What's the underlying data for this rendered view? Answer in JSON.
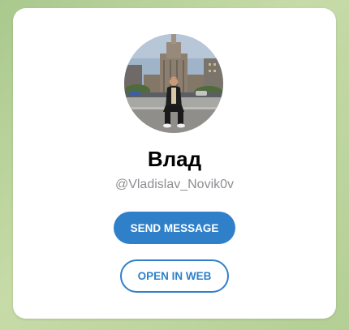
{
  "profile": {
    "display_name": "Влад",
    "username": "@Vladislav_Novik0v"
  },
  "actions": {
    "send_message_label": "SEND MESSAGE",
    "open_in_web_label": "OPEN IN WEB"
  },
  "colors": {
    "accent": "#2f80c9",
    "background": "#b9d39e",
    "card": "#ffffff",
    "username_text": "#8e8e93"
  },
  "icons": {
    "avatar": "profile-photo"
  }
}
